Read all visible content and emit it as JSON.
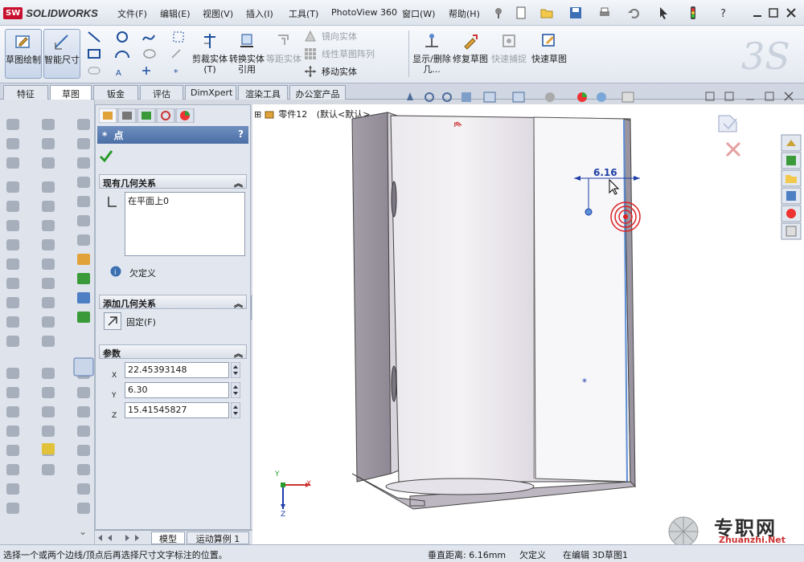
{
  "app": {
    "logo_mark": "SW",
    "logo_text": "SOLIDWORKS"
  },
  "menu": [
    {
      "label": "文件(F)"
    },
    {
      "label": "编辑(E)"
    },
    {
      "label": "视图(V)"
    },
    {
      "label": "插入(I)"
    },
    {
      "label": "工具(T)"
    },
    {
      "label": "PhotoView 360"
    },
    {
      "label": "窗口(W)"
    },
    {
      "label": "帮助(H)"
    }
  ],
  "command_manager": {
    "sketch": "草图绘制",
    "smart_dim": "智能尺寸",
    "trim": "剪裁实体(T)",
    "convert": "转换实体引用",
    "offset": "等距实体",
    "mirror": "镜向实体",
    "linear_pattern": "线性草图阵列",
    "move": "移动实体",
    "show_delete": "显示/删除几...",
    "repair": "修复草图",
    "quick_snap": "快速捕捉",
    "rapid_sketch": "快速草图"
  },
  "tabs": [
    "特征",
    "草图",
    "钣金",
    "评估",
    "DimXpert",
    "渲染工具",
    "办公室产品"
  ],
  "property_manager": {
    "title": "点",
    "help": "?",
    "existing_relations": {
      "header": "现有几何关系",
      "item": "在平面上0",
      "status": "欠定义"
    },
    "add_relations": {
      "header": "添加几何关系",
      "fix": "固定(F)"
    },
    "parameters": {
      "header": "参数",
      "x_label": "X",
      "x_value": "22.45393148",
      "y_label": "Y",
      "y_value": "6.30",
      "z_label": "Z",
      "z_value": "15.41545827"
    }
  },
  "bottom_tabs": [
    "模型",
    "运动算例 1"
  ],
  "tree": {
    "part": "零件12",
    "config": "(默认<默认>_"
  },
  "dimension": "6.16",
  "triad": {
    "x": "X",
    "y": "Y",
    "z": "Z"
  },
  "watermark": {
    "cn": "专职网",
    "en": "Zhuanzhi.Net"
  },
  "status": {
    "message": "选择一个或两个边线/顶点后再选择尺寸文字标注的位置。",
    "distance": "垂直距离: 6.16mm",
    "defined": "欠定义",
    "editing": "在编辑 3D草图1"
  }
}
